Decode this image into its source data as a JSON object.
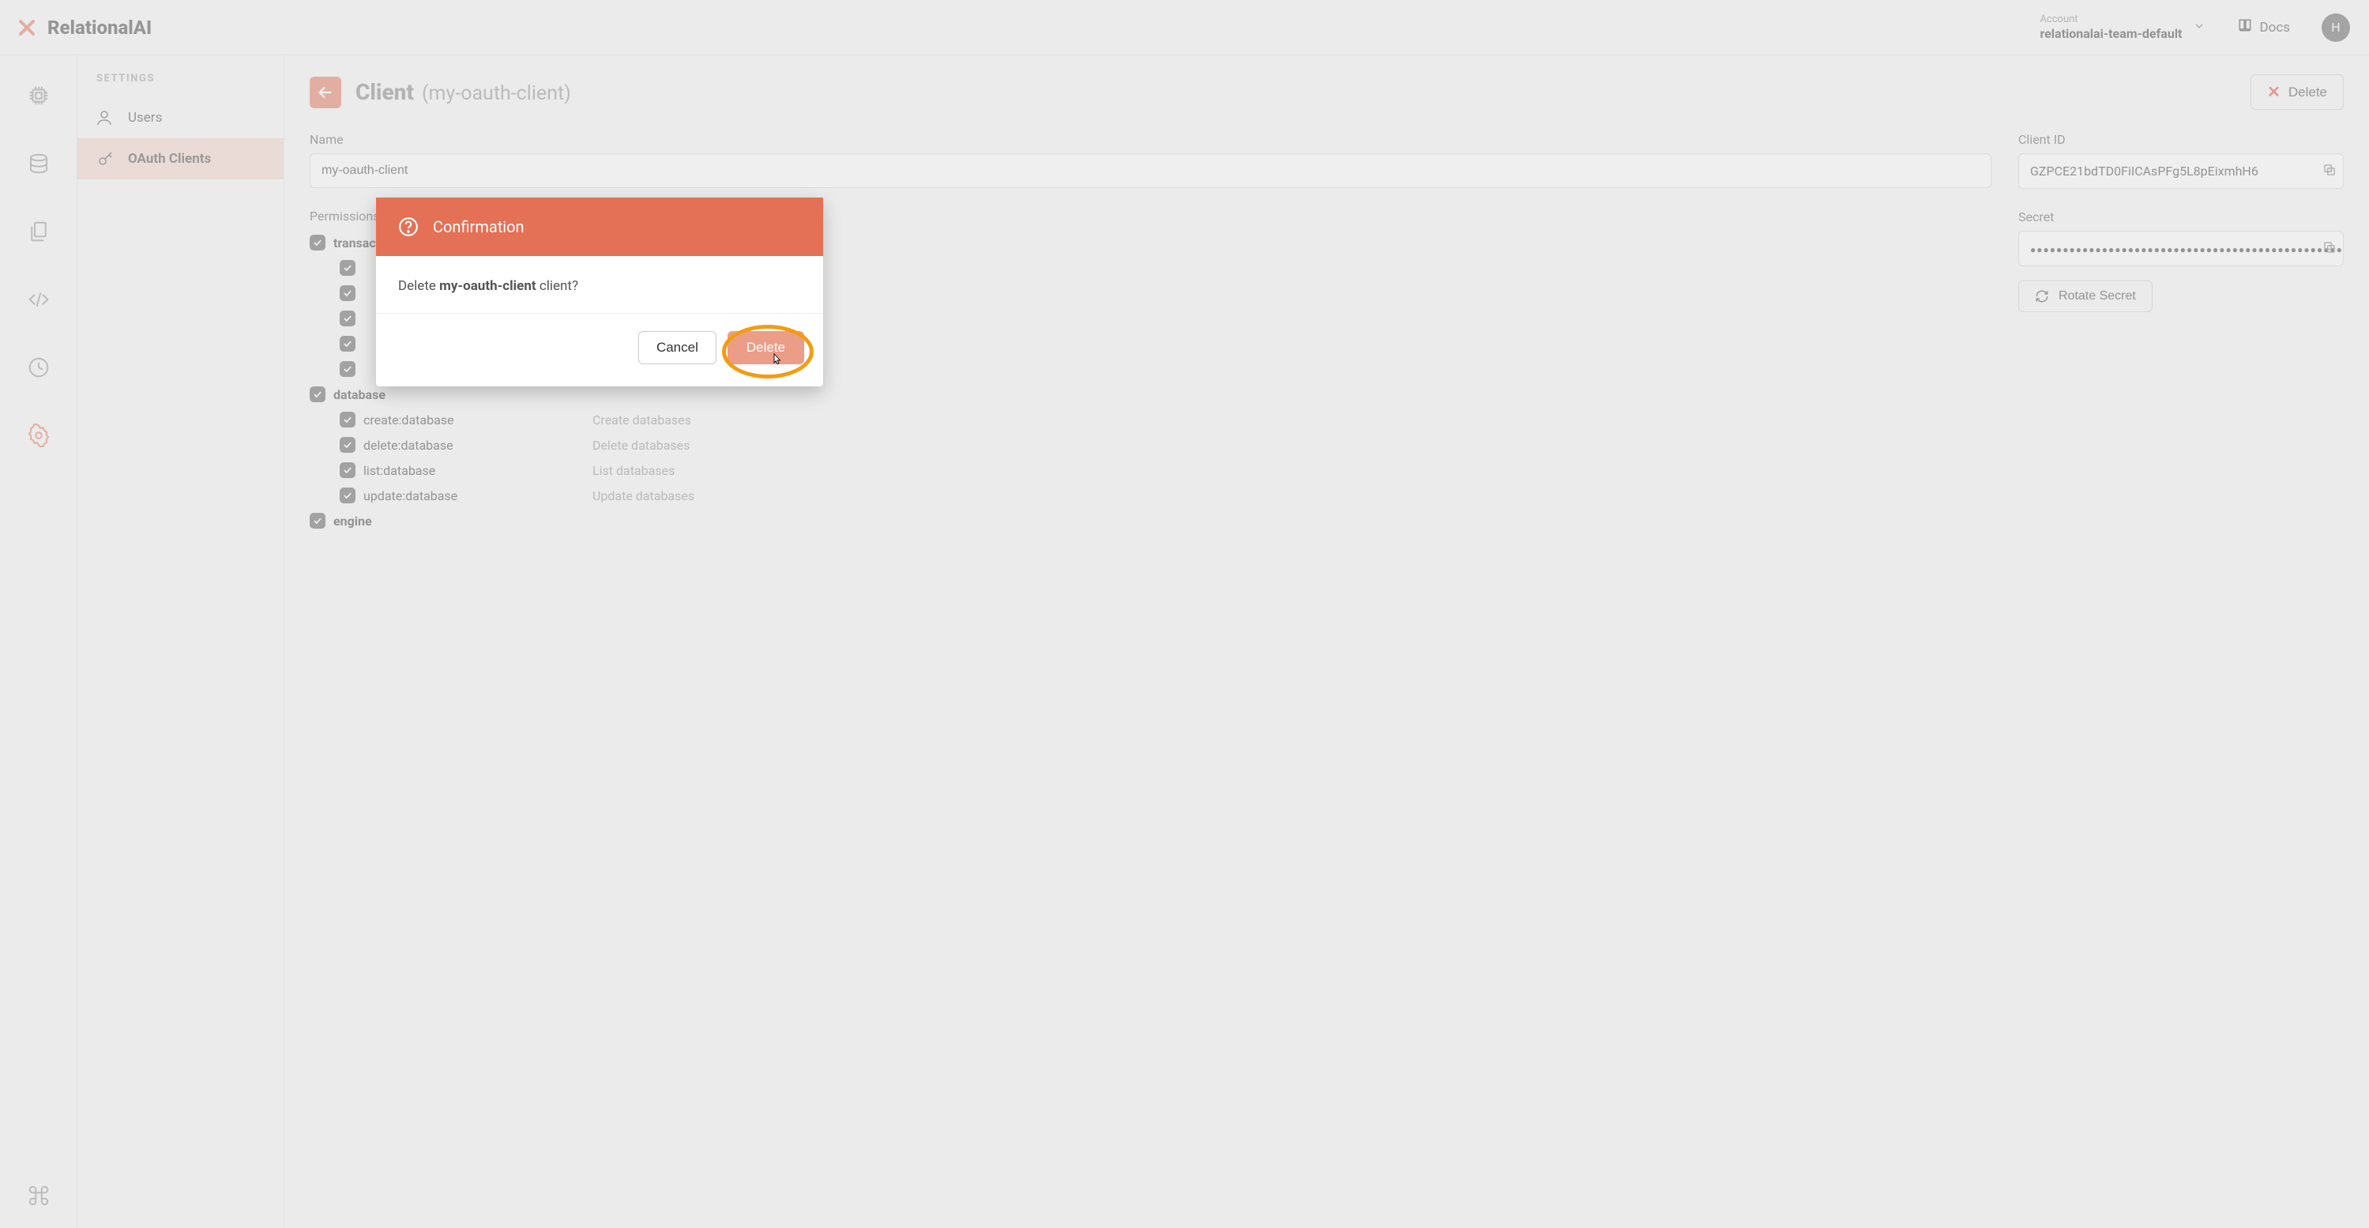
{
  "header": {
    "brand": "RelationalAI",
    "account_label": "Account",
    "account_value": "relationalai-team-default",
    "docs": "Docs",
    "avatar_initial": "H"
  },
  "sidebar": {
    "title": "SETTINGS",
    "items": [
      {
        "label": "Users"
      },
      {
        "label": "OAuth Clients"
      }
    ]
  },
  "page": {
    "title": "Client",
    "subtitle": "(my-oauth-client)",
    "delete_btn": "Delete",
    "name_label": "Name",
    "name_value": "my-oauth-client",
    "permissions_label": "Permissions",
    "client_id_label": "Client ID",
    "client_id_value": "GZPCE21bdTD0FiICAsPFg5L8pEixmhH6",
    "secret_label": "Secret",
    "rotate_secret": "Rotate Secret"
  },
  "permissions": [
    {
      "group": "transaction",
      "items": [
        {
          "name": "",
          "desc": ""
        },
        {
          "name": "",
          "desc": ""
        },
        {
          "name": "",
          "desc": ""
        },
        {
          "name": "",
          "desc": ""
        },
        {
          "name": "",
          "desc": ""
        }
      ]
    },
    {
      "group": "database",
      "items": [
        {
          "name": "create:database",
          "desc": "Create databases"
        },
        {
          "name": "delete:database",
          "desc": "Delete databases"
        },
        {
          "name": "list:database",
          "desc": "List databases"
        },
        {
          "name": "update:database",
          "desc": "Update databases"
        }
      ]
    },
    {
      "group": "engine",
      "items": []
    }
  ],
  "modal": {
    "title": "Confirmation",
    "prefix": "Delete ",
    "client_name": "my-oauth-client",
    "suffix": " client?",
    "cancel": "Cancel",
    "delete": "Delete"
  }
}
